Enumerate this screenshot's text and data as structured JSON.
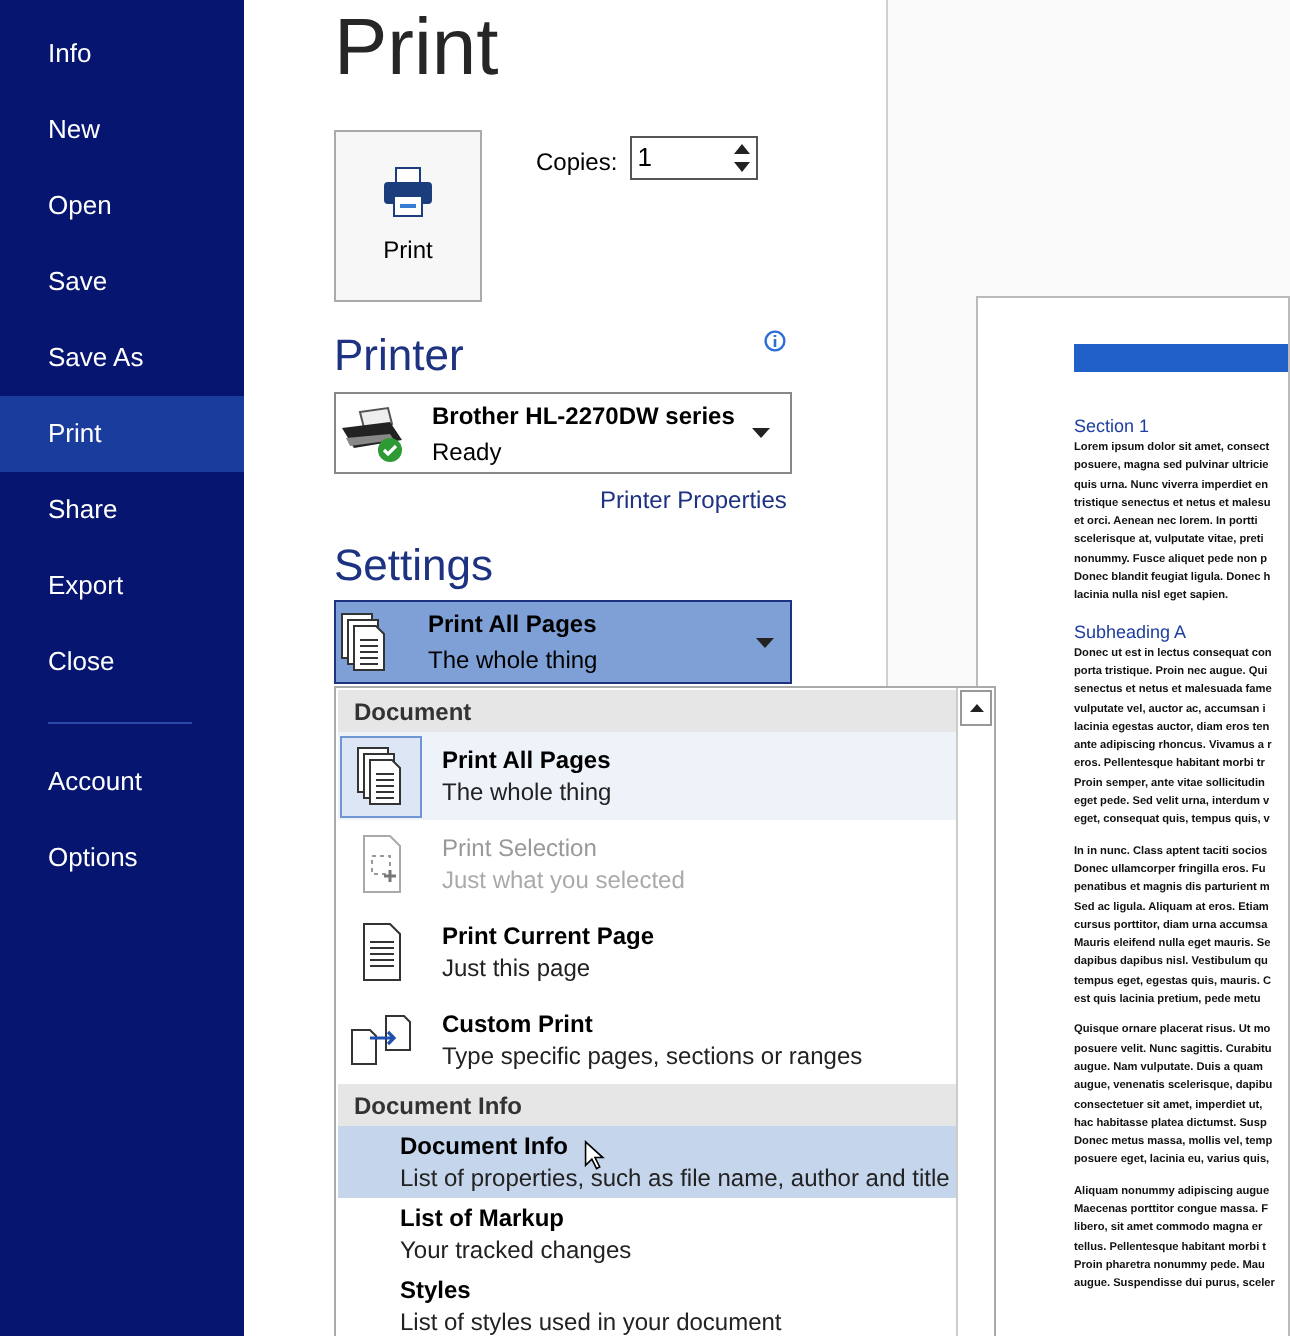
{
  "sidebar": {
    "items": [
      {
        "label": "Info",
        "selected": false
      },
      {
        "label": "New",
        "selected": false
      },
      {
        "label": "Open",
        "selected": false
      },
      {
        "label": "Save",
        "selected": false
      },
      {
        "label": "Save As",
        "selected": false
      },
      {
        "label": "Print",
        "selected": true
      },
      {
        "label": "Share",
        "selected": false
      },
      {
        "label": "Export",
        "selected": false
      },
      {
        "label": "Close",
        "selected": false
      }
    ],
    "bottom_items": [
      {
        "label": "Account",
        "selected": false
      },
      {
        "label": "Options",
        "selected": false
      }
    ]
  },
  "title": "Print",
  "print_button": "Print",
  "copies": {
    "label": "Copies:",
    "value": "1"
  },
  "printer": {
    "heading": "Printer",
    "name": "Brother HL-2270DW series",
    "status": "Ready",
    "properties_link": "Printer Properties"
  },
  "settings": {
    "heading": "Settings",
    "selection": "Print All Pages",
    "description": "The whole thing"
  },
  "menu": [
    {
      "kind": "header",
      "label": "Document"
    },
    {
      "kind": "icon-option",
      "label": "Print All Pages",
      "description": "The whole thing",
      "selected": true,
      "disabled": false
    },
    {
      "kind": "icon-option",
      "label": "Print Selection",
      "description": "Just what you selected",
      "selected": false,
      "disabled": true
    },
    {
      "kind": "icon-option",
      "label": "Print Current Page",
      "description": "Just this page",
      "selected": false,
      "disabled": false
    },
    {
      "kind": "icon-option",
      "label": "Custom Print",
      "description": "Type specific pages, sections or ranges",
      "selected": false,
      "disabled": false
    },
    {
      "kind": "header",
      "label": "Document Info"
    },
    {
      "kind": "text-option",
      "label": "Document Info",
      "description": "List of properties, such as file name, author and title",
      "highlighted": true
    },
    {
      "kind": "text-option",
      "label": "List of Markup",
      "description": "Your tracked changes",
      "highlighted": false
    },
    {
      "kind": "text-option",
      "label": "Styles",
      "description": "List of styles used in your document",
      "highlighted": false
    }
  ],
  "preview": {
    "blocks": [
      {
        "kind": "heading",
        "text": "Section 1"
      },
      {
        "kind": "paragraph",
        "lines": [
          "Lorem ipsum dolor sit amet, consect",
          "posuere, magna sed pulvinar ultricie",
          "quis urna. Nunc viverra imperdiet en",
          "tristique senectus et netus et malesu",
          "et orci. Aenean nec lorem. In portti",
          "scelerisque at, vulputate vitae, preti",
          "nonummy. Fusce aliquet pede non p",
          "Donec blandit feugiat ligula. Donec h",
          "lacinia nulla nisl eget sapien."
        ]
      },
      {
        "kind": "heading",
        "text": "Subheading A"
      },
      {
        "kind": "paragraph",
        "lines": [
          "Donec ut est in lectus consequat con",
          "porta tristique. Proin nec augue. Qui",
          "senectus et netus et malesuada fame",
          "vulputate vel, auctor ac, accumsan i",
          "lacinia egestas auctor, diam eros ten",
          "ante adipiscing rhoncus. Vivamus a r",
          "eros. Pellentesque habitant morbi tr",
          "Proin semper, ante vitae sollicitudin",
          "eget pede. Sed velit urna, interdum v",
          "eget, consequat quis, tempus quis, v"
        ]
      },
      {
        "kind": "paragraph",
        "lines": [
          "In in nunc. Class aptent taciti socios",
          "Donec ullamcorper fringilla eros. Fu",
          "penatibus et magnis dis parturient m",
          "Sed ac ligula. Aliquam at eros. Etiam",
          "cursus porttitor, diam urna accumsa",
          "Mauris eleifend nulla eget mauris. Se",
          "dapibus dapibus nisl. Vestibulum qu",
          "tempus eget, egestas quis, mauris. C",
          "est quis lacinia pretium, pede metu"
        ]
      },
      {
        "kind": "paragraph",
        "lines": [
          "Quisque ornare placerat risus. Ut mo",
          "posuere velit. Nunc sagittis. Curabitu",
          "augue. Nam vulputate. Duis a quam",
          "augue, venenatis scelerisque, dapibu",
          "consectetuer sit amet, imperdiet ut,",
          "hac habitasse platea dictumst. Susp",
          "Donec metus massa, mollis vel, temp",
          "posuere eget, lacinia eu, varius quis,"
        ]
      },
      {
        "kind": "paragraph",
        "lines": [
          "Aliquam nonummy adipiscing augue",
          "Maecenas porttitor congue massa. F",
          "libero, sit amet commodo magna er",
          "tellus. Pellentesque habitant morbi t",
          "Proin pharetra nonummy pede. Mau",
          "augue. Suspendisse dui purus, sceler"
        ]
      }
    ]
  }
}
